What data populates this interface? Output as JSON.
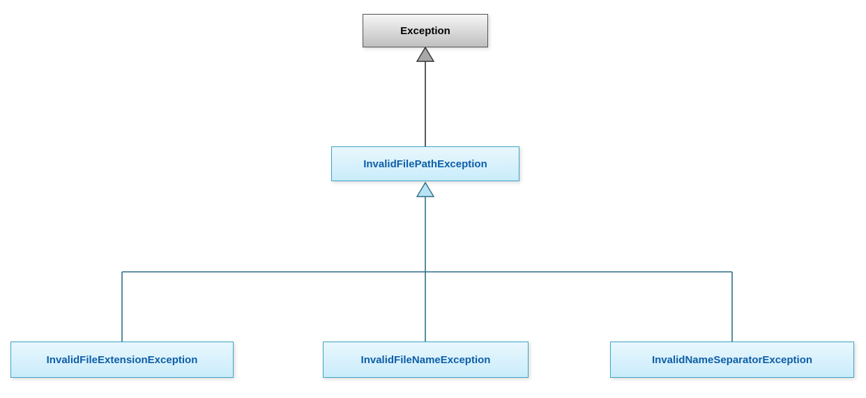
{
  "diagram": {
    "type": "uml-class-hierarchy",
    "nodes": {
      "root": {
        "label": "Exception"
      },
      "mid": {
        "label": "InvalidFilePathException"
      },
      "leaf1": {
        "label": "InvalidFileExtensionException"
      },
      "leaf2": {
        "label": "InvalidFileNameException"
      },
      "leaf3": {
        "label": "InvalidNameSeparatorException"
      }
    },
    "edges": [
      {
        "from": "mid",
        "to": "root",
        "type": "generalization"
      },
      {
        "from": "leaf1",
        "to": "mid",
        "type": "generalization"
      },
      {
        "from": "leaf2",
        "to": "mid",
        "type": "generalization"
      },
      {
        "from": "leaf3",
        "to": "mid",
        "type": "generalization"
      }
    ],
    "colors": {
      "baseFill": "#d9d9d9",
      "baseStroke": "#555555",
      "childFill": "#d6f0fb",
      "childStroke": "#3fa4c4",
      "childText": "#0e5ea8",
      "connector": "#2f6f86"
    }
  }
}
